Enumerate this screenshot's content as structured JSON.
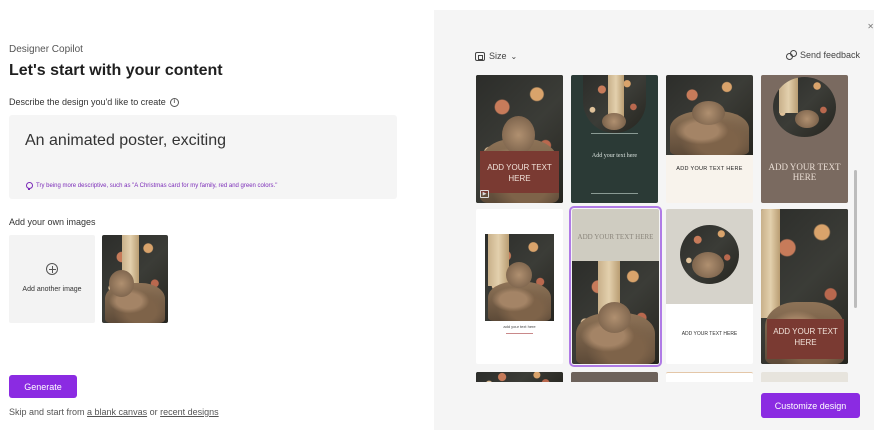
{
  "left": {
    "eyebrow": "Designer Copilot",
    "title": "Let's start with your content",
    "describe_label": "Describe the design you'd like to create",
    "prompt_value": "An animated poster, exciting",
    "hint": "Try being more descriptive, such as \"A Christmas card for my family, red and green colors.\"",
    "images_label": "Add your own images",
    "add_image_label": "Add another image",
    "generate_label": "Generate",
    "skip_prefix": "Skip and start from ",
    "blank_canvas_link": "a blank canvas",
    "skip_middle": " or ",
    "recent_designs_link": "recent designs"
  },
  "right": {
    "size_label": "Size",
    "feedback_label": "Send feedback",
    "customize_label": "Customize design",
    "cards": [
      {
        "id": "c1",
        "text": "ADD YOUR TEXT HERE"
      },
      {
        "id": "c2",
        "text": "Add your text here"
      },
      {
        "id": "c3",
        "text": "ADD YOUR TEXT HERE"
      },
      {
        "id": "c4",
        "text": "ADD YOUR TEXT HERE"
      },
      {
        "id": "c5",
        "text": "add your text here"
      },
      {
        "id": "c6",
        "text": "ADD YOUR TEXT HERE"
      },
      {
        "id": "c7",
        "text": "ADD YOUR TEXT HERE"
      },
      {
        "id": "c8",
        "text": "ADD YOUR TEXT HERE"
      }
    ]
  },
  "colors": {
    "accent": "#8b2be2",
    "selection": "#b07be6",
    "hint": "#7b2bb8",
    "maroon_box": "#7a3a32",
    "dark_teal": "#2b3a36",
    "taupe": "#7a6a60",
    "cream": "#f8f3ec"
  }
}
